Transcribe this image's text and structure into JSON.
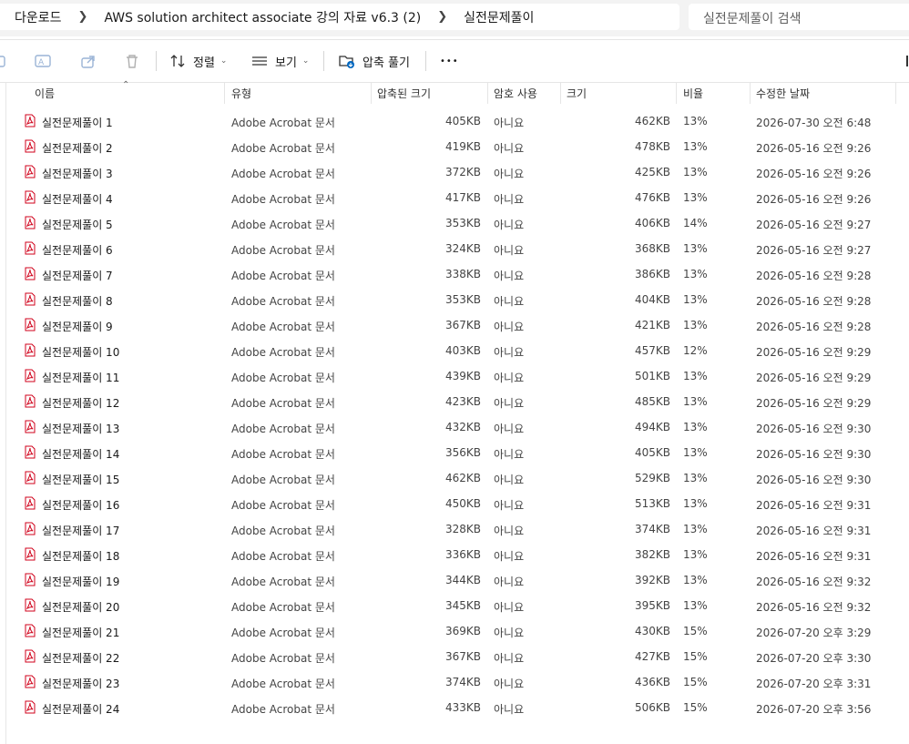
{
  "breadcrumbs": [
    "다운로드",
    "AWS solution architect associate 강의 자료 v6.3 (2)",
    "실전문제풀이"
  ],
  "search": {
    "placeholder": "실전문제풀이 검색"
  },
  "toolbar": {
    "sort_label": "정렬",
    "view_label": "보기",
    "extract_label": "압축 풀기",
    "more_label": "•••"
  },
  "columns": {
    "name": "이름",
    "type": "유형",
    "compressed": "압축된 크기",
    "password": "암호 사용",
    "size": "크기",
    "ratio": "비율",
    "modified": "수정한 날짜"
  },
  "files": [
    {
      "name": "실전문제풀이 1",
      "type": "Adobe Acrobat 문서",
      "compressed": "405KB",
      "password": "아니요",
      "size": "462KB",
      "ratio": "13%",
      "modified": "2026-07-30 오전 6:48"
    },
    {
      "name": "실전문제풀이 2",
      "type": "Adobe Acrobat 문서",
      "compressed": "419KB",
      "password": "아니요",
      "size": "478KB",
      "ratio": "13%",
      "modified": "2026-05-16 오전 9:26"
    },
    {
      "name": "실전문제풀이 3",
      "type": "Adobe Acrobat 문서",
      "compressed": "372KB",
      "password": "아니요",
      "size": "425KB",
      "ratio": "13%",
      "modified": "2026-05-16 오전 9:26"
    },
    {
      "name": "실전문제풀이 4",
      "type": "Adobe Acrobat 문서",
      "compressed": "417KB",
      "password": "아니요",
      "size": "476KB",
      "ratio": "13%",
      "modified": "2026-05-16 오전 9:26"
    },
    {
      "name": "실전문제풀이 5",
      "type": "Adobe Acrobat 문서",
      "compressed": "353KB",
      "password": "아니요",
      "size": "406KB",
      "ratio": "14%",
      "modified": "2026-05-16 오전 9:27"
    },
    {
      "name": "실전문제풀이 6",
      "type": "Adobe Acrobat 문서",
      "compressed": "324KB",
      "password": "아니요",
      "size": "368KB",
      "ratio": "13%",
      "modified": "2026-05-16 오전 9:27"
    },
    {
      "name": "실전문제풀이 7",
      "type": "Adobe Acrobat 문서",
      "compressed": "338KB",
      "password": "아니요",
      "size": "386KB",
      "ratio": "13%",
      "modified": "2026-05-16 오전 9:28"
    },
    {
      "name": "실전문제풀이 8",
      "type": "Adobe Acrobat 문서",
      "compressed": "353KB",
      "password": "아니요",
      "size": "404KB",
      "ratio": "13%",
      "modified": "2026-05-16 오전 9:28"
    },
    {
      "name": "실전문제풀이 9",
      "type": "Adobe Acrobat 문서",
      "compressed": "367KB",
      "password": "아니요",
      "size": "421KB",
      "ratio": "13%",
      "modified": "2026-05-16 오전 9:28"
    },
    {
      "name": "실전문제풀이 10",
      "type": "Adobe Acrobat 문서",
      "compressed": "403KB",
      "password": "아니요",
      "size": "457KB",
      "ratio": "12%",
      "modified": "2026-05-16 오전 9:29"
    },
    {
      "name": "실전문제풀이 11",
      "type": "Adobe Acrobat 문서",
      "compressed": "439KB",
      "password": "아니요",
      "size": "501KB",
      "ratio": "13%",
      "modified": "2026-05-16 오전 9:29"
    },
    {
      "name": "실전문제풀이 12",
      "type": "Adobe Acrobat 문서",
      "compressed": "423KB",
      "password": "아니요",
      "size": "485KB",
      "ratio": "13%",
      "modified": "2026-05-16 오전 9:29"
    },
    {
      "name": "실전문제풀이 13",
      "type": "Adobe Acrobat 문서",
      "compressed": "432KB",
      "password": "아니요",
      "size": "494KB",
      "ratio": "13%",
      "modified": "2026-05-16 오전 9:30"
    },
    {
      "name": "실전문제풀이 14",
      "type": "Adobe Acrobat 문서",
      "compressed": "356KB",
      "password": "아니요",
      "size": "405KB",
      "ratio": "13%",
      "modified": "2026-05-16 오전 9:30"
    },
    {
      "name": "실전문제풀이 15",
      "type": "Adobe Acrobat 문서",
      "compressed": "462KB",
      "password": "아니요",
      "size": "529KB",
      "ratio": "13%",
      "modified": "2026-05-16 오전 9:30"
    },
    {
      "name": "실전문제풀이 16",
      "type": "Adobe Acrobat 문서",
      "compressed": "450KB",
      "password": "아니요",
      "size": "513KB",
      "ratio": "13%",
      "modified": "2026-05-16 오전 9:31"
    },
    {
      "name": "실전문제풀이 17",
      "type": "Adobe Acrobat 문서",
      "compressed": "328KB",
      "password": "아니요",
      "size": "374KB",
      "ratio": "13%",
      "modified": "2026-05-16 오전 9:31"
    },
    {
      "name": "실전문제풀이 18",
      "type": "Adobe Acrobat 문서",
      "compressed": "336KB",
      "password": "아니요",
      "size": "382KB",
      "ratio": "13%",
      "modified": "2026-05-16 오전 9:31"
    },
    {
      "name": "실전문제풀이 19",
      "type": "Adobe Acrobat 문서",
      "compressed": "344KB",
      "password": "아니요",
      "size": "392KB",
      "ratio": "13%",
      "modified": "2026-05-16 오전 9:32"
    },
    {
      "name": "실전문제풀이 20",
      "type": "Adobe Acrobat 문서",
      "compressed": "345KB",
      "password": "아니요",
      "size": "395KB",
      "ratio": "13%",
      "modified": "2026-05-16 오전 9:32"
    },
    {
      "name": "실전문제풀이 21",
      "type": "Adobe Acrobat 문서",
      "compressed": "369KB",
      "password": "아니요",
      "size": "430KB",
      "ratio": "15%",
      "modified": "2026-07-20 오후 3:29"
    },
    {
      "name": "실전문제풀이 22",
      "type": "Adobe Acrobat 문서",
      "compressed": "367KB",
      "password": "아니요",
      "size": "427KB",
      "ratio": "15%",
      "modified": "2026-07-20 오후 3:30"
    },
    {
      "name": "실전문제풀이 23",
      "type": "Adobe Acrobat 문서",
      "compressed": "374KB",
      "password": "아니요",
      "size": "436KB",
      "ratio": "15%",
      "modified": "2026-07-20 오후 3:31"
    },
    {
      "name": "실전문제풀이 24",
      "type": "Adobe Acrobat 문서",
      "compressed": "433KB",
      "password": "아니요",
      "size": "506KB",
      "ratio": "15%",
      "modified": "2026-07-20 오후 3:56"
    }
  ],
  "icons": [
    "pdf-file-icon",
    "copy-icon",
    "rename-icon",
    "share-icon",
    "delete-icon",
    "sort-icon",
    "view-icon",
    "extract-icon",
    "chevron-right-icon"
  ],
  "colors": {
    "pdf_red": "#d0021b",
    "accent_blue": "#0067c0"
  }
}
